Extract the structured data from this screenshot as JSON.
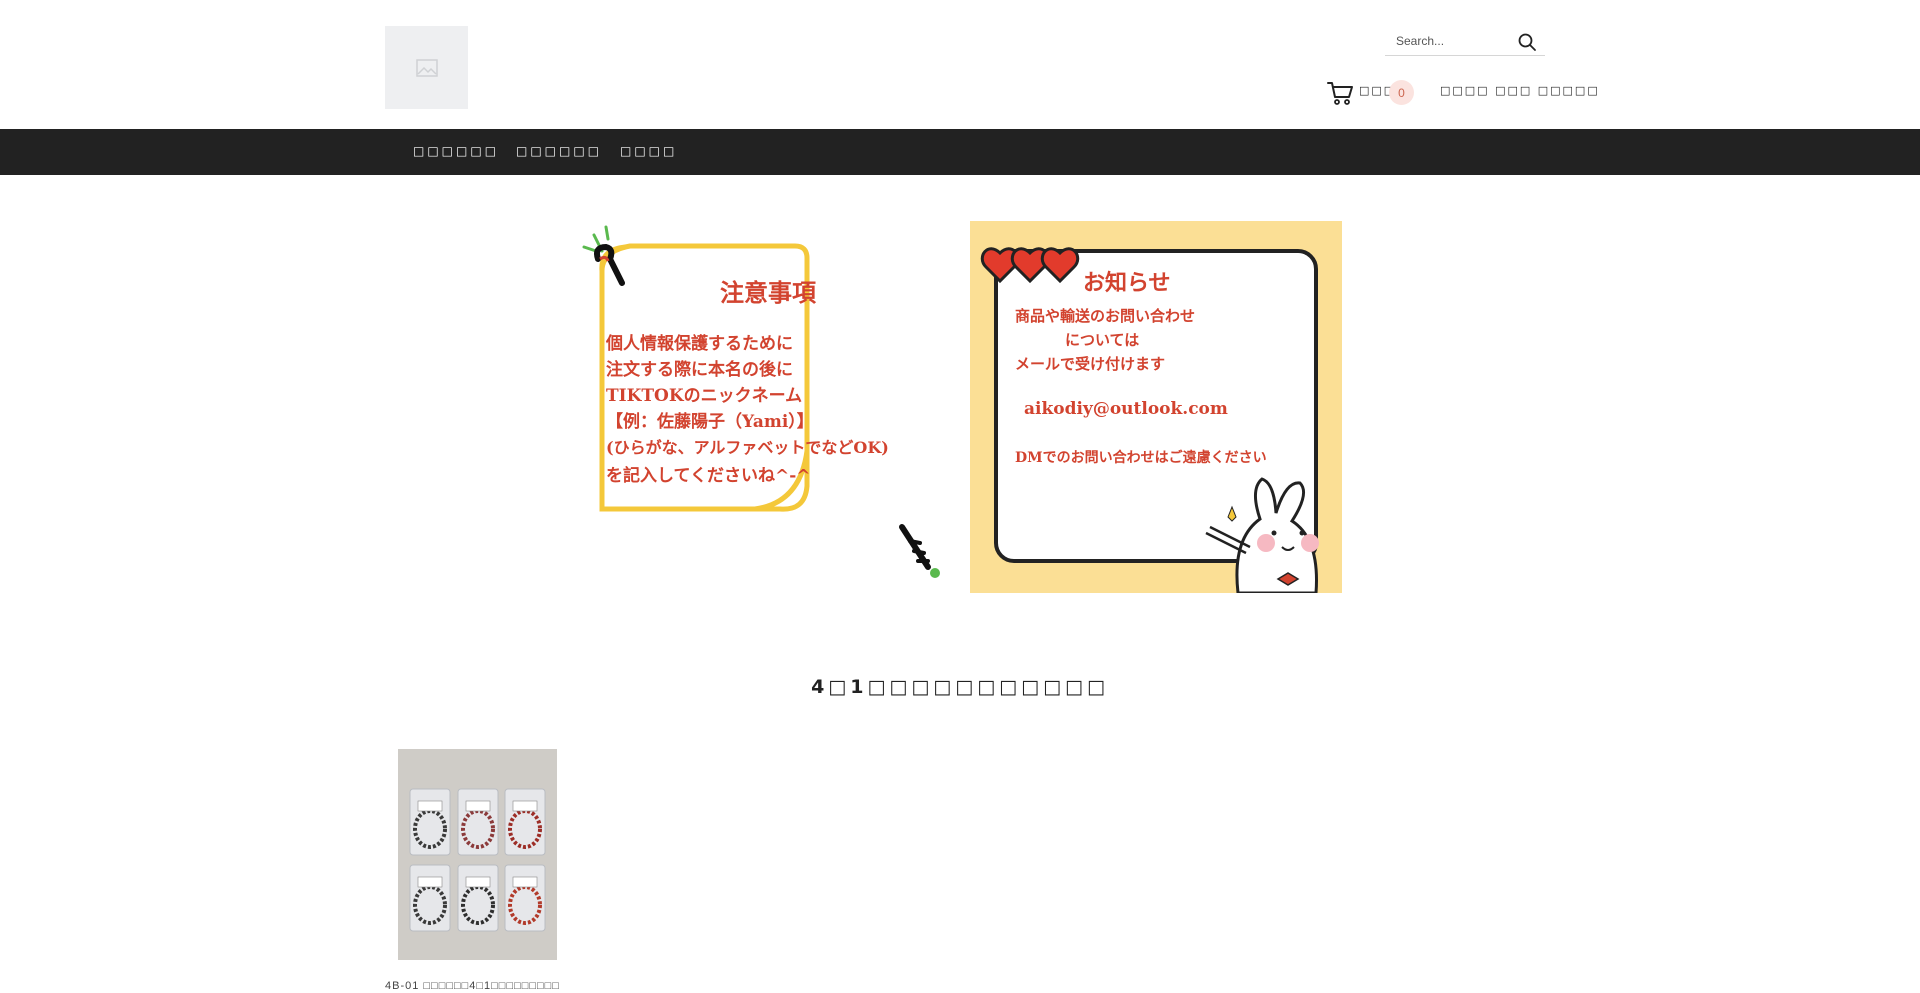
{
  "header": {
    "logo_alt": "shop-logo",
    "search": {
      "placeholder": "Search..."
    },
    "cart": {
      "label": "□□□",
      "count": "0"
    },
    "account_label": "□□□□ □□□ □□□□□"
  },
  "nav": {
    "items": [
      {
        "label": "□□□□□□"
      },
      {
        "label": "□□□□□□"
      },
      {
        "label": "□□□□"
      }
    ]
  },
  "banner_left": {
    "title": "注意事項",
    "lines": [
      "個人情報保護するために",
      "注文する際に本名の後に",
      "TIKTOKのニックネーム",
      "【例：佐藤陽子（Yami）】",
      "(ひらがな、アルファベットでなどOK)",
      "を記入してくださいね^-^"
    ]
  },
  "banner_right": {
    "title": "お知らせ",
    "lines": [
      "商品や輸送のお問い合わせ",
      "については",
      "メールで受け付けます",
      "aikodiy@outlook.com",
      "DMでのお問い合わせはご遠慮ください"
    ]
  },
  "section": {
    "title": "4□1□□□□□□□□□□□"
  },
  "products": [
    {
      "title": "4B-01 □□□□□□4□1□□□□□□□□□"
    }
  ],
  "colors": {
    "nav_bg": "#222222",
    "banner_right_bg": "#fbdf95",
    "banner_text": "#d2432f",
    "cart_badge_bg": "#fbe3df"
  },
  "icons": {
    "search": "search-icon",
    "cart": "cart-icon",
    "logo": "image-placeholder-icon"
  }
}
